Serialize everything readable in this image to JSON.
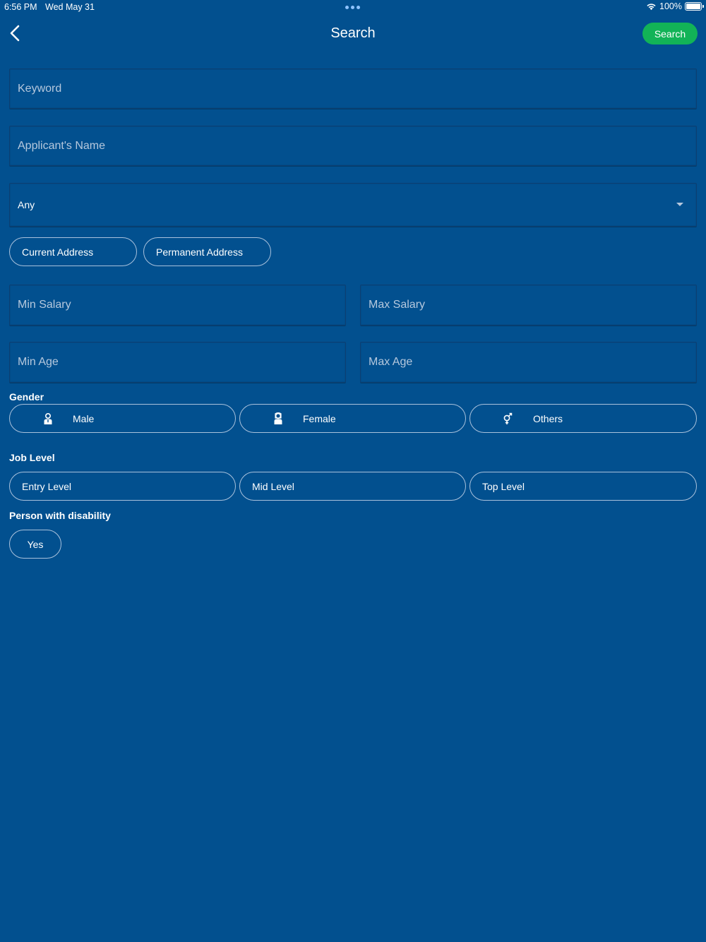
{
  "status_bar": {
    "time": "6:56 PM",
    "date": "Wed May 31",
    "battery": "100%"
  },
  "nav": {
    "title": "Search",
    "search_button": "Search"
  },
  "fields": {
    "keyword_placeholder": "Keyword",
    "applicant_name_placeholder": "Applicant's Name",
    "location_select_value": "Any",
    "min_salary_placeholder": "Min Salary",
    "max_salary_placeholder": "Max Salary",
    "min_age_placeholder": "Min Age",
    "max_age_placeholder": "Max Age"
  },
  "address_chips": {
    "current": "Current Address",
    "permanent": "Permanent Address"
  },
  "gender": {
    "label": "Gender",
    "options": [
      "Male",
      "Female",
      "Others"
    ]
  },
  "job_level": {
    "label": "Job Level",
    "options": [
      "Entry Level",
      "Mid Level",
      "Top Level"
    ]
  },
  "disability": {
    "label": "Person with disability",
    "option": "Yes"
  },
  "colors": {
    "background": "#02508f",
    "accent_button": "#12b357",
    "chip_border": "#a9c1dc",
    "placeholder": "#b6c8dd"
  },
  "icons": [
    "back-chevron-icon",
    "male-icon",
    "female-icon",
    "gender-others-icon",
    "dropdown-caret-icon",
    "wifi-icon",
    "battery-icon"
  ]
}
